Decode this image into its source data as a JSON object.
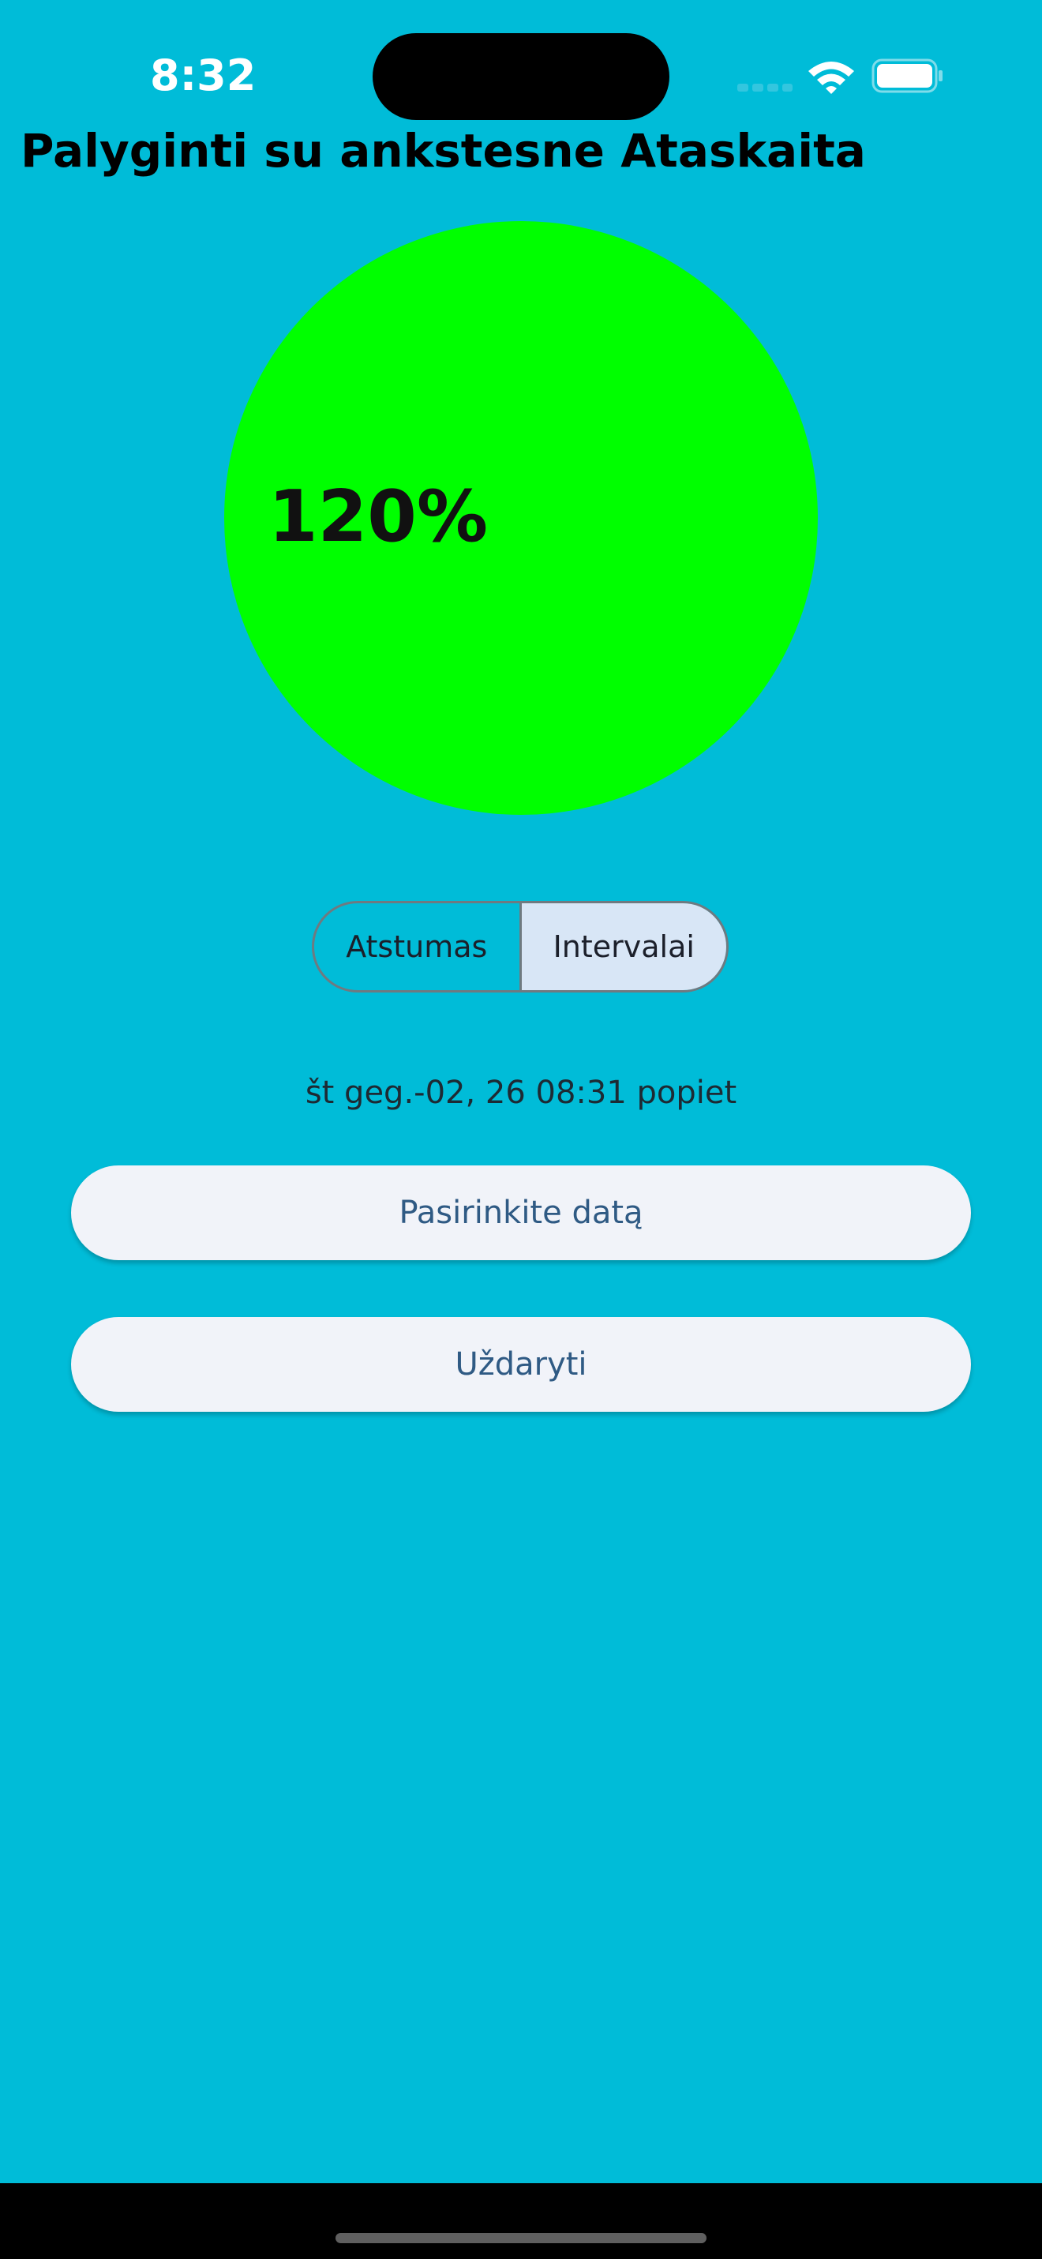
{
  "status_bar": {
    "time": "8:32",
    "icons": [
      "cellular-signal-icon",
      "wifi-icon",
      "battery-icon"
    ]
  },
  "header": {
    "title": "Palyginti su ankstesne Ataskaita"
  },
  "gauge": {
    "label": "120%",
    "value_percent": 120,
    "color": "#00FF00"
  },
  "segmented_control": {
    "options": [
      "Atstumas",
      "Intervalai"
    ],
    "selected": "Intervalai"
  },
  "report": {
    "date_text": "št geg.-02, 26 08:31 popiet"
  },
  "buttons": {
    "pick_date": "Pasirinkite datą",
    "close": "Uždaryti"
  },
  "colors": {
    "background": "#00BCD8",
    "button_background": "#F1F3F9",
    "button_text": "#2F5A84",
    "segment_selected": "#D8E6F6"
  }
}
